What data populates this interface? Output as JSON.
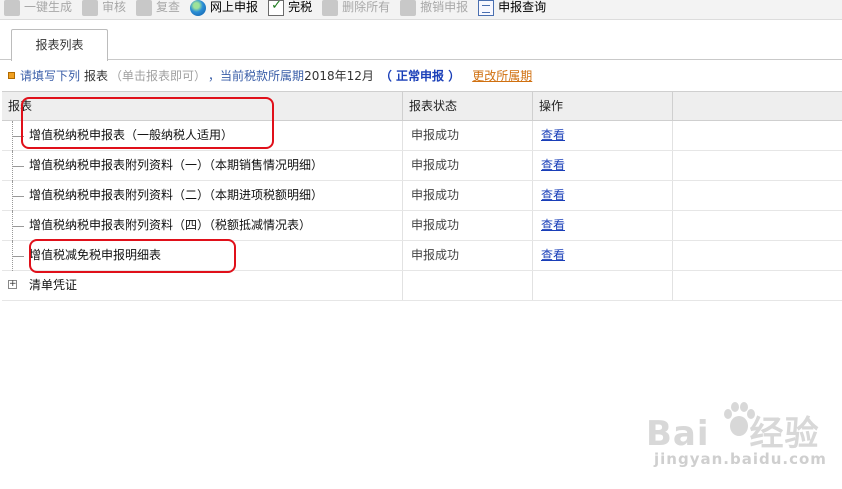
{
  "toolbar": {
    "items": [
      {
        "label": "一键生成",
        "icon": "generate-icon",
        "enabled": false
      },
      {
        "label": "审核",
        "icon": "audit-icon",
        "enabled": false
      },
      {
        "label": "复查",
        "icon": "recheck-icon",
        "enabled": false
      },
      {
        "label": "网上申报",
        "icon": "globe-icon",
        "enabled": true
      },
      {
        "label": "完税",
        "icon": "tax-paid-check-icon",
        "enabled": true
      },
      {
        "label": "删除所有",
        "icon": "delete-all-icon",
        "enabled": false
      },
      {
        "label": "撤销申报",
        "icon": "undo-declare-icon",
        "enabled": false
      },
      {
        "label": "申报查询",
        "icon": "declare-query-doc-icon",
        "enabled": true
      }
    ]
  },
  "tab": {
    "label": "报表列表"
  },
  "info": {
    "prefix": "请填写下列",
    "report_word": "报表",
    "hint": "（单击报表即可）",
    "period_text": "，当前税款所属期",
    "period_value": "2018年12月",
    "status": "（ 正常申报 ）",
    "change_link": "更改所属期"
  },
  "grid": {
    "headers": [
      "报表",
      "报表状态",
      "操作"
    ],
    "rows": [
      {
        "name": "增值税纳税申报表（一般纳税人适用）",
        "status": "申报成功",
        "action": "查看",
        "highlighted": true
      },
      {
        "name": "增值税纳税申报表附列资料（一）（本期销售情况明细）",
        "status": "申报成功",
        "action": "查看",
        "highlighted": false
      },
      {
        "name": "增值税纳税申报表附列资料（二）（本期进项税额明细）",
        "status": "申报成功",
        "action": "查看",
        "highlighted": false
      },
      {
        "name": "增值税纳税申报表附列资料（四）（税额抵减情况表）",
        "status": "申报成功",
        "action": "查看",
        "highlighted": false
      },
      {
        "name": "增值税减免税申报明细表",
        "status": "申报成功",
        "action": "查看",
        "highlighted": true
      }
    ],
    "group_row": {
      "name": "清单凭证"
    }
  },
  "colors": {
    "highlight": "#e0101a",
    "link": "#1a3fb8",
    "orange_link": "#d07010"
  },
  "watermark": {
    "main": "Bai",
    "main2": "经验",
    "sub": "jingyan.baidu.com"
  }
}
